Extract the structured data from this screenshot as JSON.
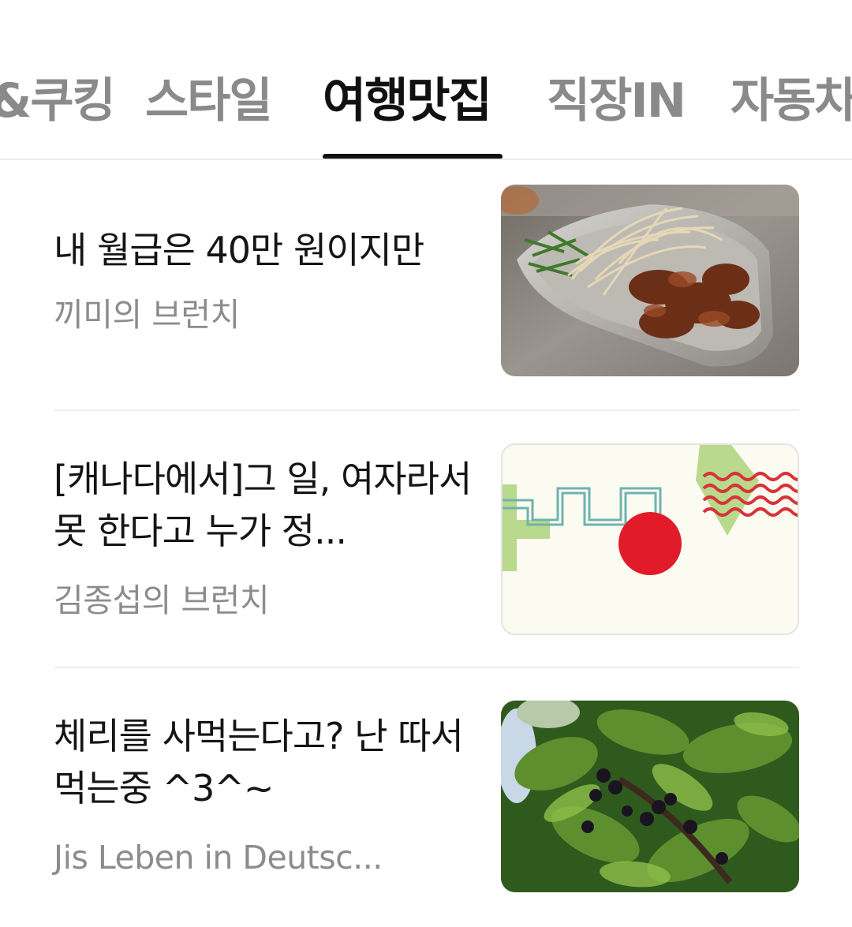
{
  "tabs": [
    {
      "label": "&쿠킹",
      "active": false
    },
    {
      "label": "스타일",
      "active": false
    },
    {
      "label": "여행맛집",
      "active": true
    },
    {
      "label": "직장IN",
      "active": false
    },
    {
      "label": "자동차",
      "active": false
    }
  ],
  "articles": [
    {
      "title": "내 월급은 40만 원이지만",
      "author": "끼미의 브런치",
      "thumbnail": "food-dish-image"
    },
    {
      "title": "[캐나다에서]그 일, 여자라서 못 한다고 누가 정...",
      "author": "김종섭의 브런치",
      "thumbnail": "abstract-graphic-image"
    },
    {
      "title": "체리를 사먹는다고? 난 따서 먹는중 ^3^~",
      "author": "Jis Leben in Deutsc...",
      "thumbnail": "cherry-tree-image"
    }
  ],
  "colors": {
    "active_tab": "#111111",
    "inactive_tab": "#8a8a8a",
    "title": "#151515",
    "author": "#8c8c8c",
    "divider": "#eeeeee"
  }
}
